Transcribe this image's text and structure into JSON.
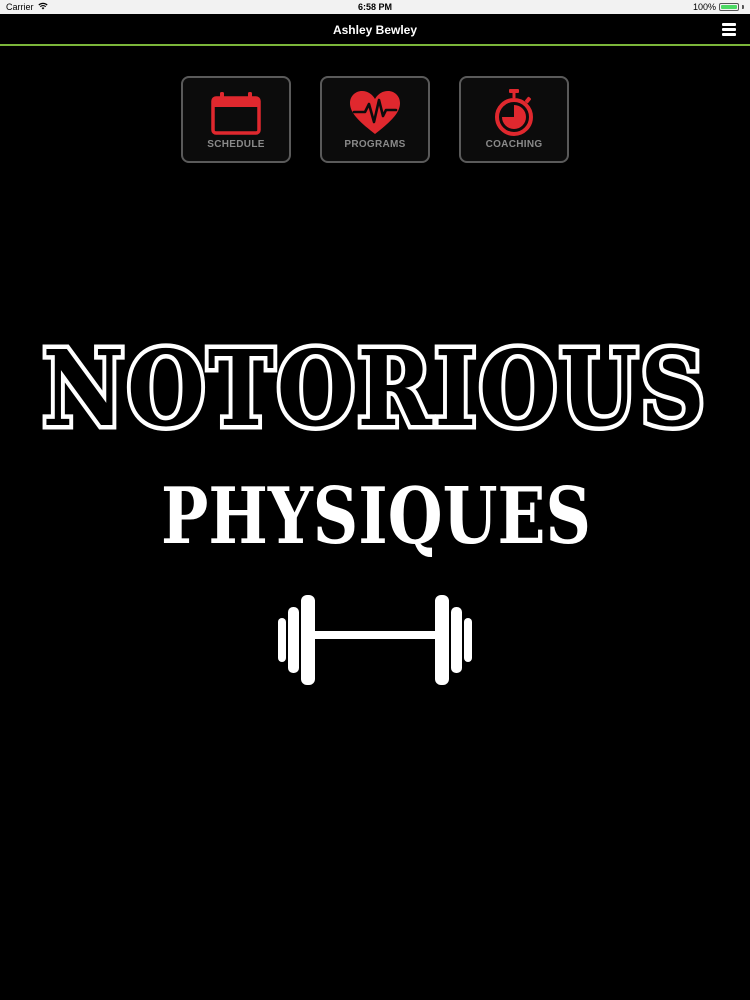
{
  "status_bar": {
    "carrier": "Carrier",
    "time": "6:58 PM",
    "battery": "100%",
    "battery_level": 1.0,
    "wifi_icon": "wifi-icon"
  },
  "nav": {
    "title": "Ashley Bewley",
    "menu_icon": "hamburger-menu-icon"
  },
  "tiles": [
    {
      "label": "SCHEDULE",
      "icon": "calendar-icon"
    },
    {
      "label": "PROGRAMS",
      "icon": "heart-pulse-icon"
    },
    {
      "label": "COACHING",
      "icon": "stopwatch-icon"
    }
  ],
  "logo": {
    "line1": "NOTORIOUS",
    "line2": "PHYSIQUES",
    "icon": "barbell-icon"
  },
  "colors": {
    "background": "#000000",
    "accent_green": "#7bb53a",
    "icon_red": "#e0282e",
    "tile_border": "#5a5a5a",
    "tile_label": "#8a8a8a",
    "logo_white": "#ffffff"
  }
}
